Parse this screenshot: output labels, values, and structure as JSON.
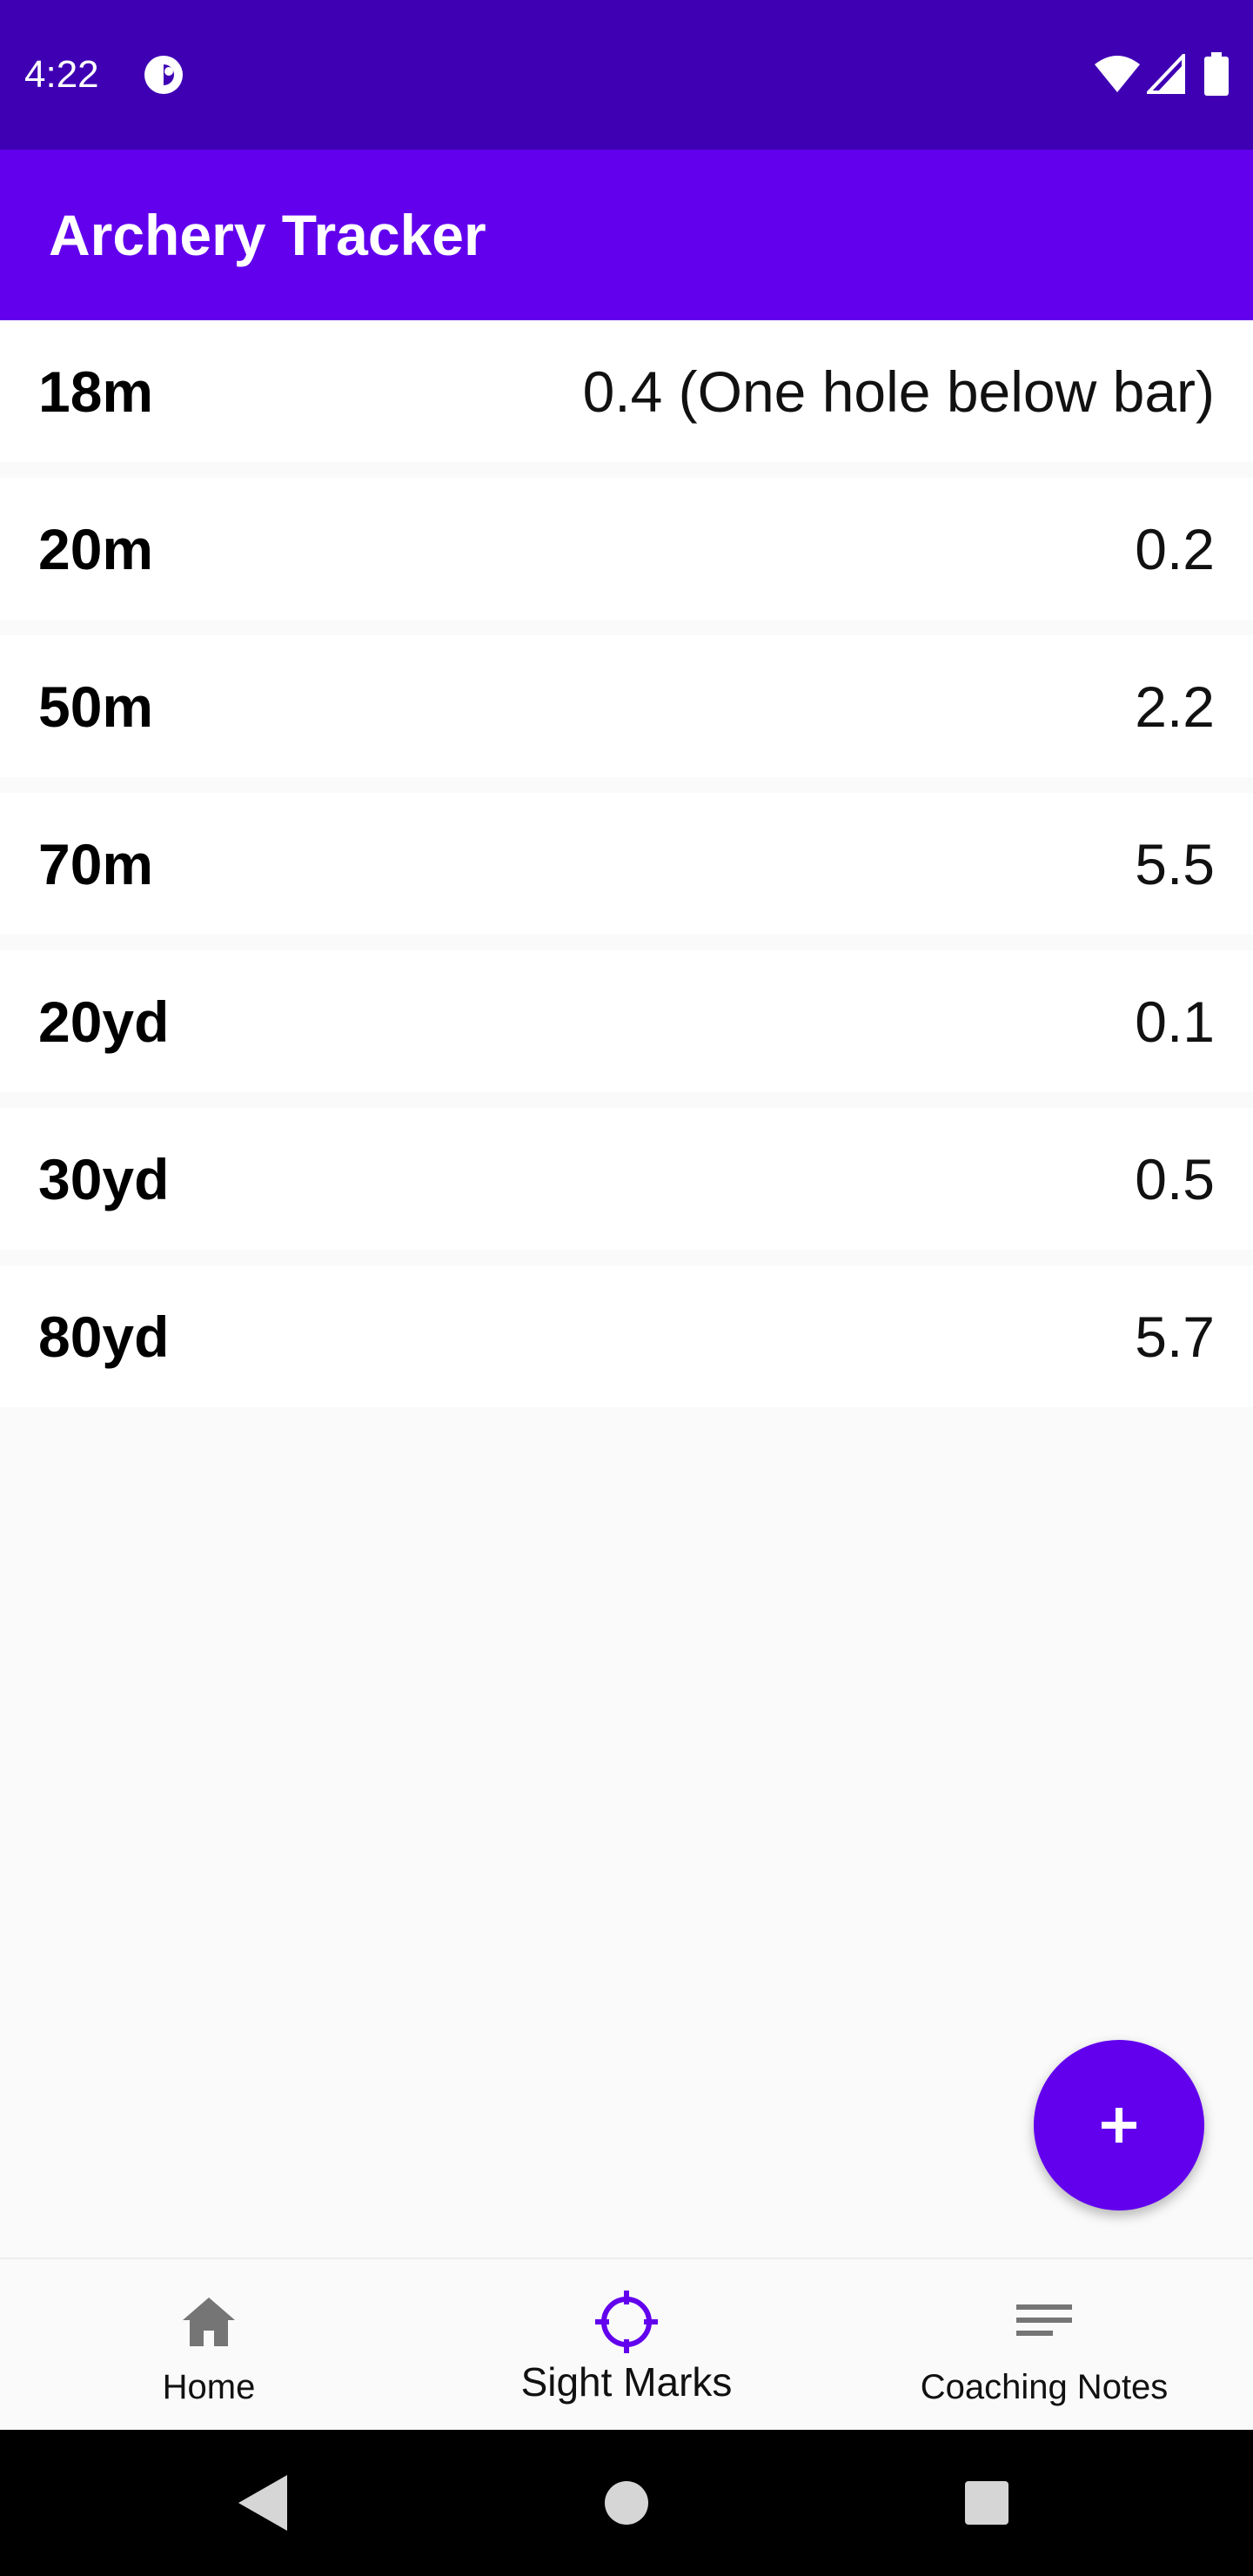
{
  "status_bar": {
    "time": "4:22",
    "app_icon": "circle-app-icon",
    "wifi_icon": "wifi-icon",
    "signal_icon": "cell-signal-icon",
    "battery_icon": "battery-icon"
  },
  "app_bar": {
    "title": "Archery Tracker",
    "color": "#6200ee",
    "status_color": "#3f00b4"
  },
  "sight_marks": [
    {
      "distance": "18m",
      "mark": "0.4 (One hole below bar)"
    },
    {
      "distance": "20m",
      "mark": "0.2"
    },
    {
      "distance": "50m",
      "mark": "2.2"
    },
    {
      "distance": "70m",
      "mark": "5.5"
    },
    {
      "distance": "20yd",
      "mark": "0.1"
    },
    {
      "distance": "30yd",
      "mark": "0.5"
    },
    {
      "distance": "80yd",
      "mark": "5.7"
    }
  ],
  "fab": {
    "icon": "plus-icon"
  },
  "bottom_nav": {
    "items": [
      {
        "label": "Home",
        "icon": "home-icon",
        "active": false
      },
      {
        "label": "Sight Marks",
        "icon": "crosshair-icon",
        "active": true
      },
      {
        "label": "Coaching Notes",
        "icon": "notes-icon",
        "active": false
      }
    ],
    "active_color": "#6200ee",
    "inactive_icon_color": "#757575"
  },
  "system_nav": {
    "back_icon": "back-triangle-icon",
    "home_icon": "home-circle-icon",
    "recents_icon": "recents-square-icon"
  }
}
